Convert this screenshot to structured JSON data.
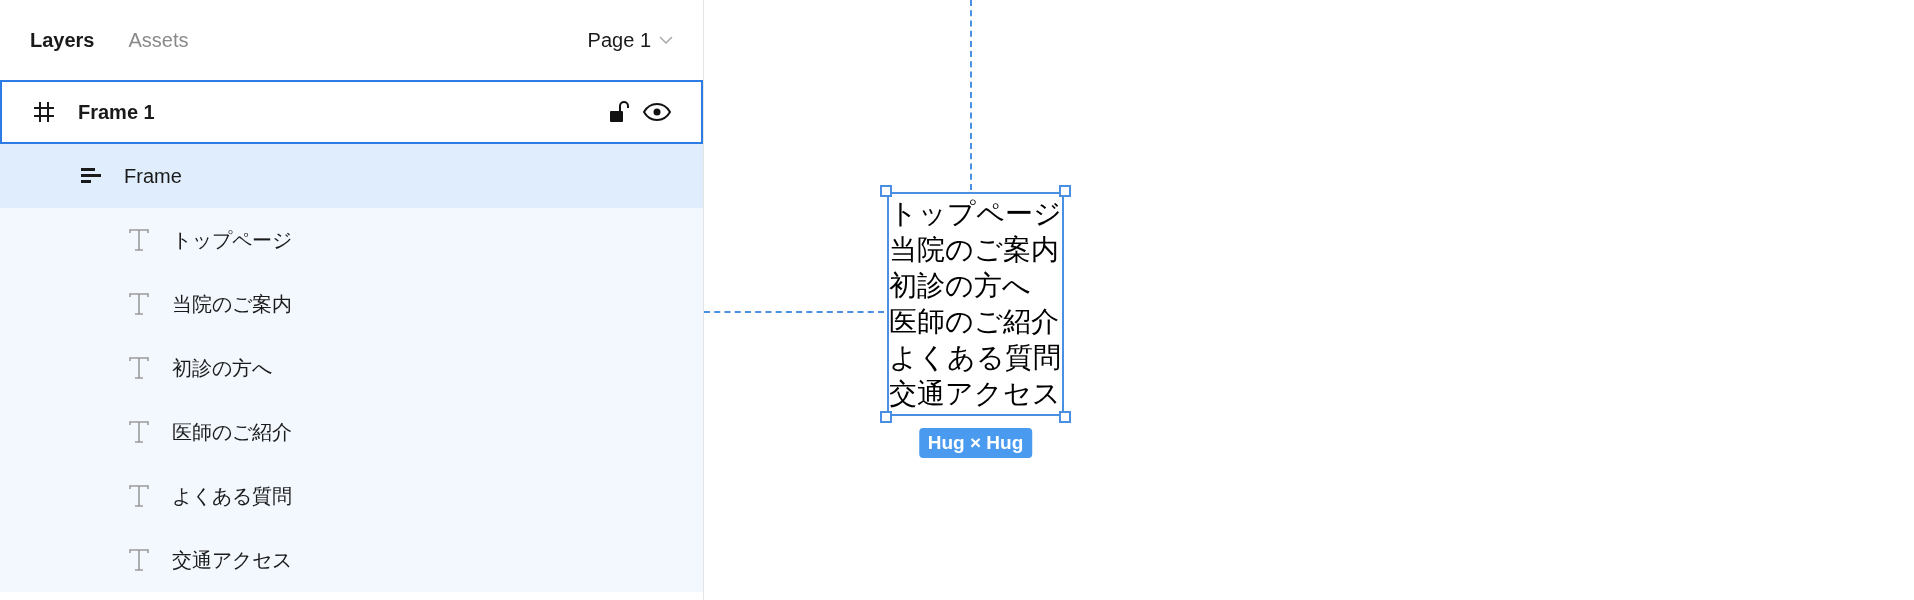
{
  "tabs": [
    {
      "label": "Layers",
      "selected": true
    },
    {
      "label": "Assets",
      "selected": false
    }
  ],
  "page_selector": {
    "label": "Page 1"
  },
  "layers": [
    {
      "kind": "frame",
      "name": "Frame 1",
      "selected": true,
      "locked": false,
      "visible": true,
      "children": [
        {
          "kind": "stack",
          "name": "Frame",
          "selected": false,
          "hovered": true,
          "children": [
            {
              "kind": "text",
              "name": "トップページ",
              "selected": false
            },
            {
              "kind": "text",
              "name": "当院のご案内",
              "selected": false
            },
            {
              "kind": "text",
              "name": "初診の方へ",
              "selected": false
            },
            {
              "kind": "text",
              "name": "医師のご紹介",
              "selected": false
            },
            {
              "kind": "text",
              "name": "よくある質問",
              "selected": false
            },
            {
              "kind": "text",
              "name": "交通アクセス",
              "selected": false
            }
          ]
        }
      ]
    }
  ],
  "canvas": {
    "lines": [
      "トップページ",
      "当院のご案内",
      "初診の方へ",
      "医師のご紹介",
      "よくある質問",
      "交通アクセス"
    ],
    "size_badge": "Hug × Hug"
  }
}
